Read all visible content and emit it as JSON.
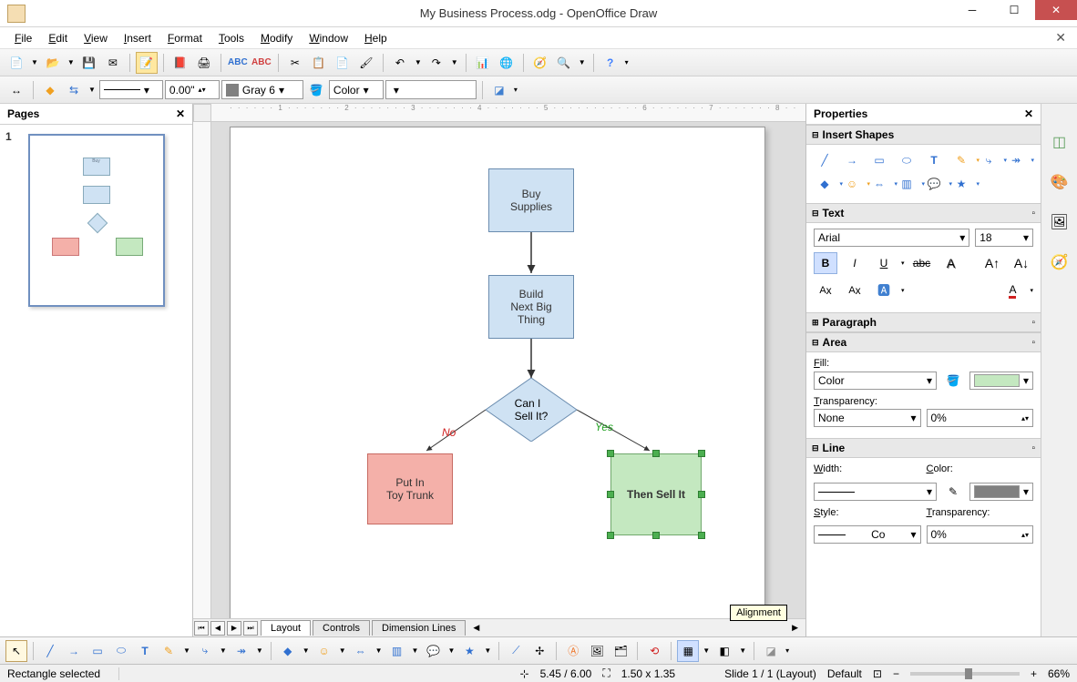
{
  "titlebar": {
    "title": "My Business Process.odg - OpenOffice Draw"
  },
  "menubar": {
    "items": [
      "File",
      "Edit",
      "View",
      "Insert",
      "Format",
      "Tools",
      "Modify",
      "Window",
      "Help"
    ]
  },
  "toolbar2": {
    "line_width": "0.00\"",
    "line_color_label": "Gray 6",
    "fill_type": "Color"
  },
  "ruler_h_text": "· · · · · · 1 · · · · · · · 2 · · · · · · · 3 · · · · · · · 4 · · · · · · · 5 · · · · · · · · · · · 6 · · · · · · · 7 · · · · · · · 8 · ·",
  "pages_panel": {
    "title": "Pages"
  },
  "sheet_tabs": [
    "Layout",
    "Controls",
    "Dimension Lines"
  ],
  "tooltip": "Alignment",
  "flowchart": {
    "box1": "Buy\nSupplies",
    "box2": "Build\nNext Big\nThing",
    "diamond": "Can I\nSell It?",
    "no_label": "No",
    "yes_label": "Yes",
    "box_left": "Put In\nToy Trunk",
    "box_right": "Then Sell It"
  },
  "properties": {
    "title": "Properties",
    "sections": {
      "insert_shapes": "Insert Shapes",
      "text": "Text",
      "paragraph": "Paragraph",
      "area": "Area",
      "line": "Line"
    },
    "font_name": "Arial",
    "font_size": "18",
    "fill_label": "Fill:",
    "fill_type": "Color",
    "transparency_label": "Transparency:",
    "transparency_type": "None",
    "transparency_value": "0%",
    "width_label": "Width:",
    "color_label": "Color:",
    "style_label": "Style:",
    "style_value": "Co",
    "line_transparency_label": "Transparency:",
    "line_transparency_value": "0%"
  },
  "statusbar": {
    "selection": "Rectangle selected",
    "pos": "5.45 / 6.00",
    "size": "1.50 x 1.35",
    "slide": "Slide 1 / 1 (Layout)",
    "style": "Default",
    "zoom": "66%"
  }
}
